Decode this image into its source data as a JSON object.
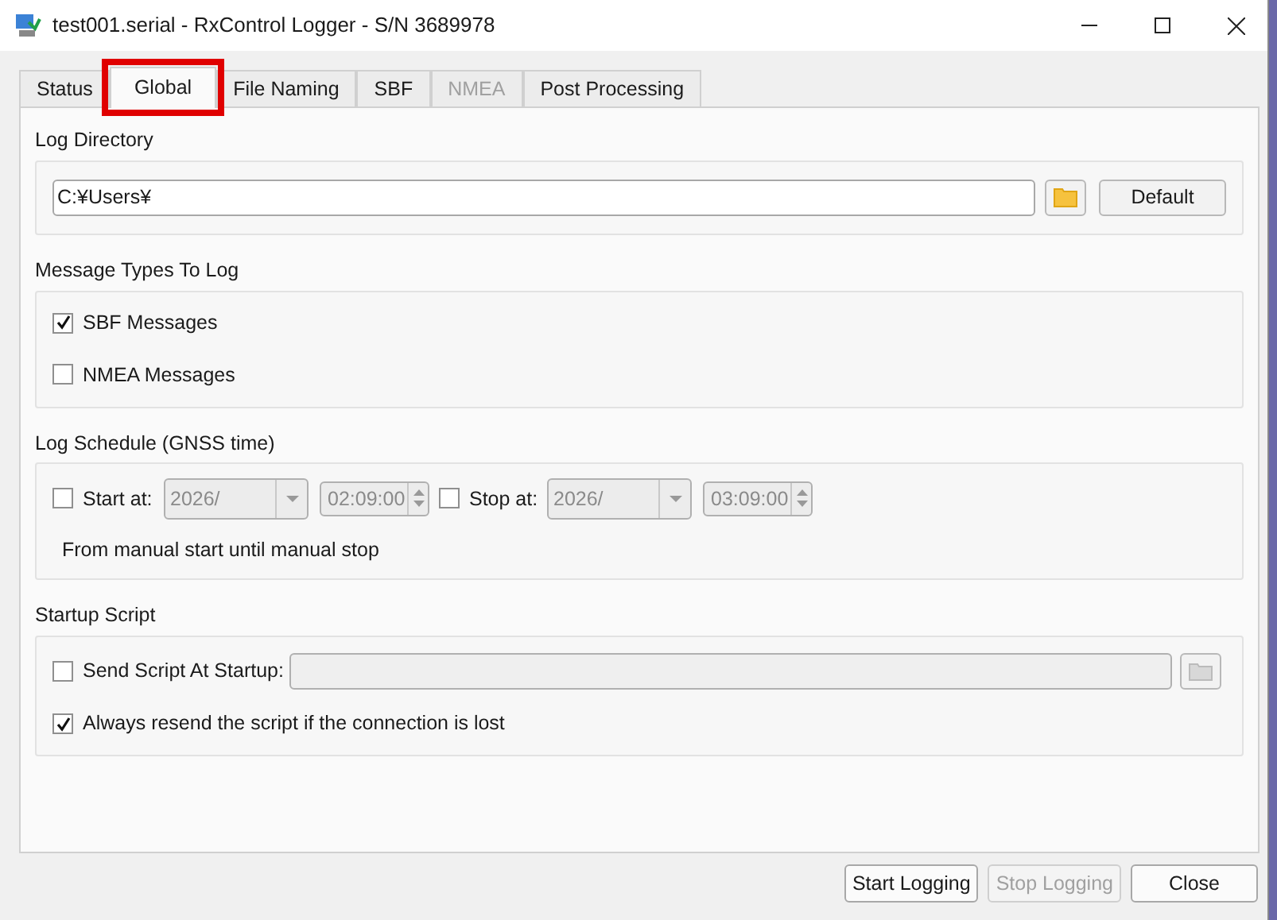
{
  "window": {
    "title": "test001.serial - RxControl Logger - S/N 3689978"
  },
  "tabs": [
    {
      "label": "Status",
      "selected": false,
      "disabled": false,
      "highlighted": false
    },
    {
      "label": "Global",
      "selected": true,
      "disabled": false,
      "highlighted": true
    },
    {
      "label": "File Naming",
      "selected": false,
      "disabled": false,
      "highlighted": false
    },
    {
      "label": "SBF",
      "selected": false,
      "disabled": false,
      "highlighted": false
    },
    {
      "label": "NMEA",
      "selected": false,
      "disabled": true,
      "highlighted": false
    },
    {
      "label": "Post Processing",
      "selected": false,
      "disabled": false,
      "highlighted": false
    }
  ],
  "log_directory": {
    "heading": "Log Directory",
    "path": "C:¥Users¥",
    "default_button": "Default"
  },
  "message_types": {
    "heading": "Message Types To Log",
    "options": [
      {
        "label": "SBF Messages",
        "checked": true
      },
      {
        "label": "NMEA Messages",
        "checked": false
      }
    ]
  },
  "log_schedule": {
    "heading": "Log Schedule (GNSS time)",
    "start": {
      "label": "Start at:",
      "checked": false,
      "date": "2026/",
      "time": "02:09:00"
    },
    "stop": {
      "label": "Stop at:",
      "checked": false,
      "date": "2026/",
      "time": "03:09:00"
    },
    "summary": "From manual start until manual stop"
  },
  "startup_script": {
    "heading": "Startup Script",
    "send_script": {
      "label": "Send Script At Startup:",
      "checked": false
    },
    "resend": {
      "label": "Always resend the script if the connection is lost",
      "checked": true
    }
  },
  "buttons": [
    {
      "label": "Start Logging",
      "disabled": false
    },
    {
      "label": "Stop Logging",
      "disabled": true
    },
    {
      "label": "Close",
      "disabled": false
    }
  ]
}
